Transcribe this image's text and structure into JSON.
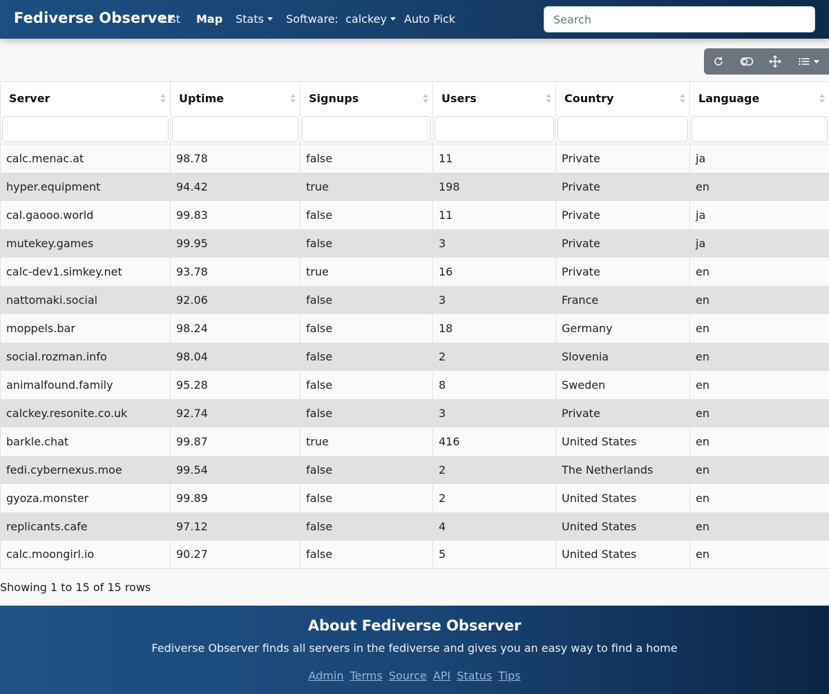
{
  "navbar": {
    "brand": "Fediverse Observer",
    "items": [
      {
        "label": "List",
        "active": false
      },
      {
        "label": "Map",
        "active": true
      },
      {
        "label": "Stats",
        "dropdown": true
      },
      {
        "label": "Software:  calckey",
        "dropdown": true
      },
      {
        "label": "Auto Pick"
      }
    ],
    "search_placeholder": "Search"
  },
  "toolbar": {
    "buttons": [
      "refresh-icon",
      "toggle-icon",
      "fullscreen-icon",
      "columns-list-icon"
    ]
  },
  "table": {
    "columns": [
      "Server",
      "Uptime",
      "Signups",
      "Users",
      "Country",
      "Language"
    ],
    "rows": [
      [
        "calc.menac.at",
        "98.78",
        "false",
        "11",
        "Private",
        "ja"
      ],
      [
        "hyper.equipment",
        "94.42",
        "true",
        "198",
        "Private",
        "en"
      ],
      [
        "cal.gaooo.world",
        "99.83",
        "false",
        "11",
        "Private",
        "ja"
      ],
      [
        "mutekey.games",
        "99.95",
        "false",
        "3",
        "Private",
        "ja"
      ],
      [
        "calc-dev1.simkey.net",
        "93.78",
        "true",
        "16",
        "Private",
        "en"
      ],
      [
        "nattomaki.social",
        "92.06",
        "false",
        "3",
        "France",
        "en"
      ],
      [
        "moppels.bar",
        "98.24",
        "false",
        "18",
        "Germany",
        "en"
      ],
      [
        "social.rozman.info",
        "98.04",
        "false",
        "2",
        "Slovenia",
        "en"
      ],
      [
        "animalfound.family",
        "95.28",
        "false",
        "8",
        "Sweden",
        "en"
      ],
      [
        "calckey.resonite.co.uk",
        "92.74",
        "false",
        "3",
        "Private",
        "en"
      ],
      [
        "barkle.chat",
        "99.87",
        "true",
        "416",
        "United States",
        "en"
      ],
      [
        "fedi.cybernexus.moe",
        "99.54",
        "false",
        "2",
        "The Netherlands",
        "en"
      ],
      [
        "gyoza.monster",
        "99.89",
        "false",
        "2",
        "United States",
        "en"
      ],
      [
        "replicants.cafe",
        "97.12",
        "false",
        "4",
        "United States",
        "en"
      ],
      [
        "calc.moongirl.io",
        "90.27",
        "false",
        "5",
        "United States",
        "en"
      ]
    ],
    "showing": "Showing 1 to 15 of 15 rows"
  },
  "footer": {
    "title": "About Fediverse Observer",
    "tagline": "Fediverse Observer finds all servers in the fediverse and gives you an easy way to find a home",
    "links": [
      "Admin",
      "Terms",
      "Source",
      "API",
      "Status",
      "Tips"
    ]
  }
}
